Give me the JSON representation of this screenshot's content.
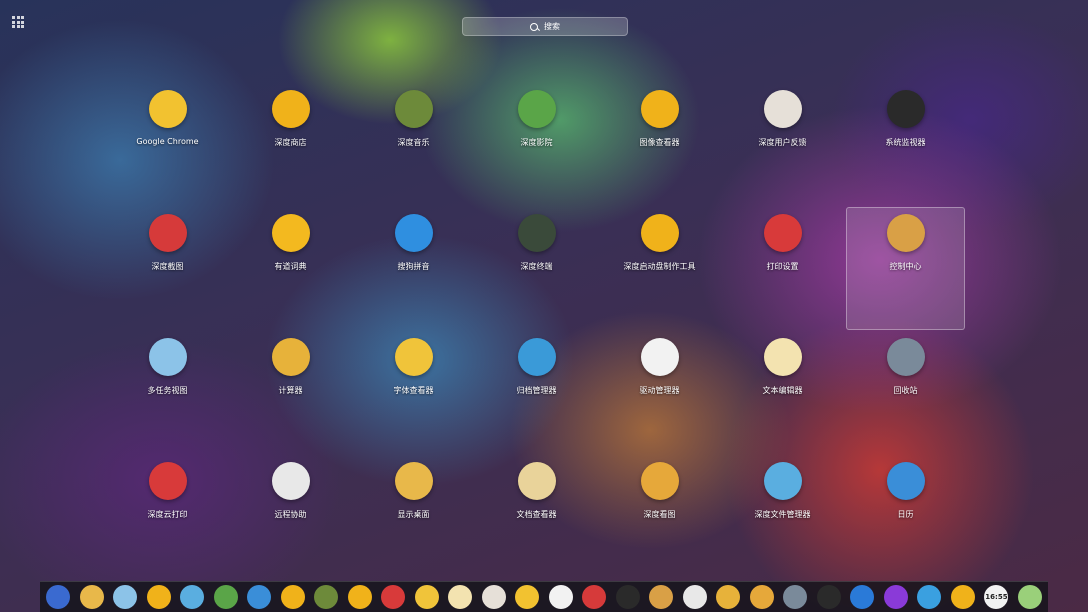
{
  "search": {
    "placeholder": "搜索"
  },
  "apps": [
    {
      "label": "Google Chrome",
      "icon": "chrome-icon",
      "color": "#f2c230"
    },
    {
      "label": "深度商店",
      "icon": "store-star-icon",
      "color": "#f0b21a"
    },
    {
      "label": "深度音乐",
      "icon": "music-turtle-icon",
      "color": "#6d8a3a"
    },
    {
      "label": "深度影院",
      "icon": "movie-play-icon",
      "color": "#5aa548"
    },
    {
      "label": "图像查看器",
      "icon": "diving-mask-icon",
      "color": "#f0b21a"
    },
    {
      "label": "深度用户反馈",
      "icon": "bottle-icon",
      "color": "#e6e0d8"
    },
    {
      "label": "系统监视器",
      "icon": "skull-headphones-icon",
      "color": "#2a2a2a"
    },
    {
      "label": "深度截图",
      "icon": "crab-icon",
      "color": "#d63a3a"
    },
    {
      "label": "有道词典",
      "icon": "dictionary-icon",
      "color": "#f3b91f"
    },
    {
      "label": "搜狗拼音",
      "icon": "sogou-s-icon",
      "color": "#2f8fe0"
    },
    {
      "label": "深度终端",
      "icon": "terminal-flag-icon",
      "color": "#3a4a3a"
    },
    {
      "label": "深度启动盘制作工具",
      "icon": "fan-icon",
      "color": "#f0b21a"
    },
    {
      "label": "打印设置",
      "icon": "octopus-printer-icon",
      "color": "#d83a3a"
    },
    {
      "label": "控制中心",
      "icon": "ship-wheel-icon",
      "color": "#d9a046"
    },
    {
      "label": "多任务视图",
      "icon": "map-icon",
      "color": "#8cc3e8"
    },
    {
      "label": "计算器",
      "icon": "compass-icon",
      "color": "#e7b23a"
    },
    {
      "label": "字体查看器",
      "icon": "font-bottles-icon",
      "color": "#f0c43a"
    },
    {
      "label": "归档管理器",
      "icon": "anchor-icon",
      "color": "#3a9ad8"
    },
    {
      "label": "驱动管理器",
      "icon": "captain-hat-icon",
      "color": "#f2f2f2"
    },
    {
      "label": "文本编辑器",
      "icon": "paper-quill-icon",
      "color": "#f3e3b0"
    },
    {
      "label": "回收站",
      "icon": "shark-icon",
      "color": "#7a8a9a"
    },
    {
      "label": "深度云打印",
      "icon": "octopus-sailor-icon",
      "color": "#d83a3a"
    },
    {
      "label": "远程协助",
      "icon": "lifebuoy-icon",
      "color": "#e8e8e8"
    },
    {
      "label": "显示桌面",
      "icon": "island-icon",
      "color": "#e8b84a"
    },
    {
      "label": "文档查看器",
      "icon": "document-icon",
      "color": "#e9d39a"
    },
    {
      "label": "深度看图",
      "icon": "porthole-icon",
      "color": "#e6a83a"
    },
    {
      "label": "深度文件管理器",
      "icon": "folder-icon",
      "color": "#5aaee0"
    },
    {
      "label": "日历",
      "icon": "whale-calendar-icon",
      "color": "#3a8ed8"
    }
  ],
  "dock": [
    {
      "icon": "launcher-icon",
      "color": "#3a6ad0"
    },
    {
      "icon": "island-icon",
      "color": "#e8b84a"
    },
    {
      "icon": "map-icon",
      "color": "#8cc3e8"
    },
    {
      "icon": "diving-mask-icon",
      "color": "#f0b21a"
    },
    {
      "icon": "folder-icon",
      "color": "#5aaee0"
    },
    {
      "icon": "movie-play-icon",
      "color": "#5aa548"
    },
    {
      "icon": "whale-calendar-icon",
      "color": "#3a8ed8"
    },
    {
      "icon": "store-star-icon",
      "color": "#f0b21a"
    },
    {
      "icon": "music-turtle-icon",
      "color": "#6d8a3a"
    },
    {
      "icon": "fan-icon",
      "color": "#f0b21a"
    },
    {
      "icon": "octopus-printer-icon",
      "color": "#d83a3a"
    },
    {
      "icon": "font-bottles-icon",
      "color": "#f0c43a"
    },
    {
      "icon": "paper-quill-icon",
      "color": "#f3e3b0"
    },
    {
      "icon": "bottle-icon",
      "color": "#e6e0d8"
    },
    {
      "icon": "chrome-icon",
      "color": "#f2c230"
    },
    {
      "icon": "captain-hat-icon",
      "color": "#f2f2f2"
    },
    {
      "icon": "crab-icon",
      "color": "#d63a3a"
    },
    {
      "icon": "skull-headphones-icon",
      "color": "#2a2a2a"
    },
    {
      "icon": "ship-wheel-icon",
      "color": "#d9a046"
    },
    {
      "icon": "lifebuoy-icon",
      "color": "#e8e8e8"
    },
    {
      "icon": "compass-icon",
      "color": "#e7b23a"
    },
    {
      "icon": "porthole-icon",
      "color": "#e6a83a"
    },
    {
      "icon": "shark-icon",
      "color": "#7a8a9a"
    },
    {
      "icon": "terminal-icon",
      "color": "#2a2a2a"
    },
    {
      "icon": "network-icon",
      "color": "#2a7ad8"
    },
    {
      "icon": "power-icon",
      "color": "#8a3ad8"
    },
    {
      "icon": "system-monitor-icon",
      "color": "#3aa0e0"
    },
    {
      "icon": "clock-icon",
      "color": "#f0b21a"
    },
    {
      "icon": "clock-time-icon",
      "color": "#f2f2f2",
      "text": "16:55"
    },
    {
      "icon": "trash-icon",
      "color": "#9ad07a"
    }
  ],
  "selected_app": "控制中心"
}
